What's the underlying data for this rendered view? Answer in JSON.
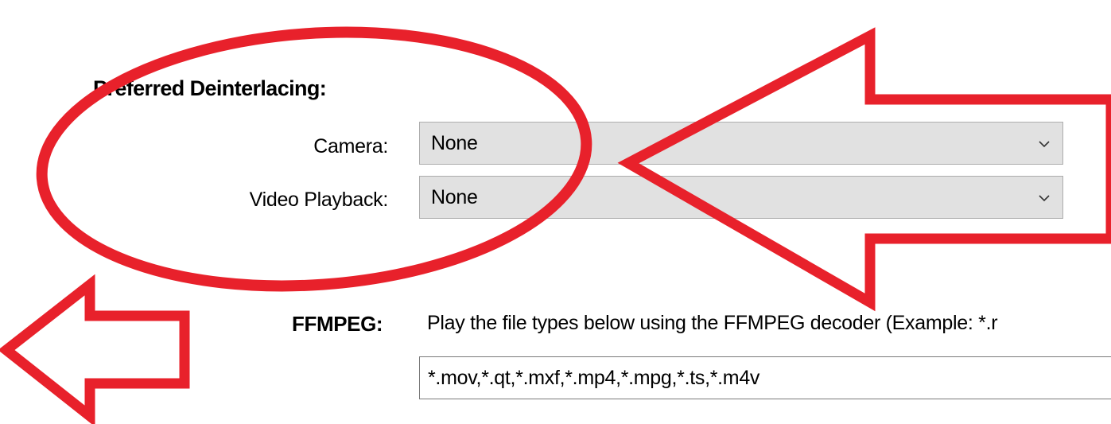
{
  "section": {
    "title": "Preferred Deinterlacing:"
  },
  "camera": {
    "label": "Camera:",
    "value": "None"
  },
  "video_playback": {
    "label": "Video Playback:",
    "value": "None"
  },
  "ffmpeg": {
    "label": "FFMPEG:",
    "description": "Play the file types below using the FFMPEG decoder (Example: *.r",
    "file_types": "*.mov,*.qt,*.mxf,*.mp4,*.mpg,*.ts,*.m4v"
  },
  "icons": {
    "dropdown": "chevron-down-icon"
  },
  "colors": {
    "annotation": "#e8212b",
    "combo_bg": "#e1e1e1"
  }
}
